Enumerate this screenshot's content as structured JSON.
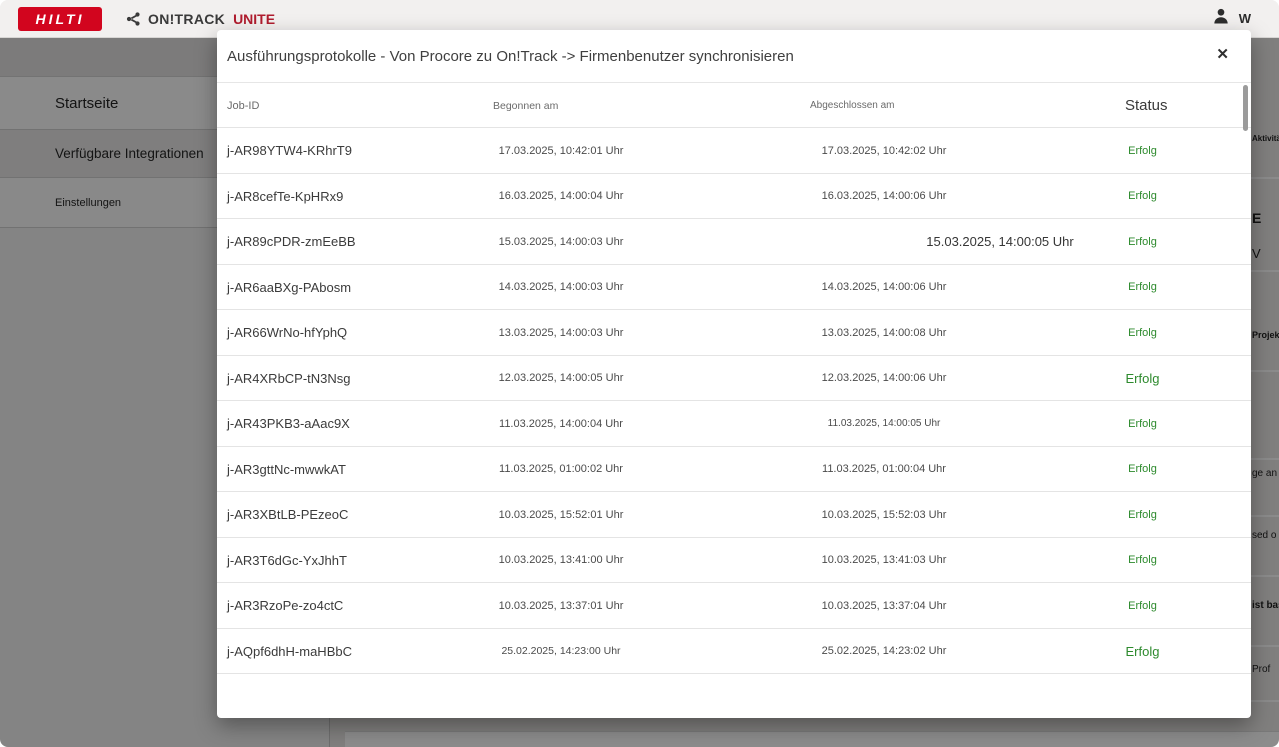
{
  "header": {
    "logo_text": "HILTI",
    "brand_name": "ON!TRACK",
    "brand_suffix": "UNITE",
    "user_name": "W"
  },
  "sidebar": {
    "items": [
      {
        "label": "Startseite"
      },
      {
        "label": "Verfügbare Integrationen"
      },
      {
        "label": "Einstellungen"
      }
    ]
  },
  "background_fragments": [
    "Aktivitä",
    "E",
    "V",
    "Projekt",
    "ge an",
    "sed o",
    "ist bas",
    "Prof"
  ],
  "modal": {
    "title": "Ausführungsprotokolle - Von Procore zu On!Track -> Firmenbenutzer synchronisieren",
    "close_icon": "✕",
    "table": {
      "columns": [
        "Job-ID",
        "Begonnen am",
        "Abgeschlossen am",
        "Status"
      ],
      "rows": [
        {
          "job_id": "j-AR98YTW4-KRhrT9",
          "started": "17.03.2025, 10:42:01 Uhr",
          "completed": "17.03.2025, 10:42:02 Uhr",
          "status": "Erfolg"
        },
        {
          "job_id": "j-AR8cefTe-KpHRx9",
          "started": "16.03.2025, 14:00:04 Uhr",
          "completed": "16.03.2025, 14:00:06 Uhr",
          "status": "Erfolg"
        },
        {
          "job_id": "j-AR89cPDR-zmEeBB",
          "started": "15.03.2025, 14:00:03 Uhr",
          "completed": "15.03.2025, 14:00:05 Uhr",
          "status": "Erfolg"
        },
        {
          "job_id": "j-AR6aaBXg-PAbosm",
          "started": "14.03.2025, 14:00:03 Uhr",
          "completed": "14.03.2025, 14:00:06 Uhr",
          "status": "Erfolg"
        },
        {
          "job_id": "j-AR66WrNo-hfYphQ",
          "started": "13.03.2025, 14:00:03 Uhr",
          "completed": "13.03.2025, 14:00:08 Uhr",
          "status": "Erfolg"
        },
        {
          "job_id": "j-AR4XRbCP-tN3Nsg",
          "started": "12.03.2025, 14:00:05 Uhr",
          "completed": "12.03.2025, 14:00:06 Uhr",
          "status": "Erfolg"
        },
        {
          "job_id": "j-AR43PKB3-aAac9X",
          "started": "11.03.2025, 14:00:04 Uhr",
          "completed": "11.03.2025, 14:00:05 Uhr",
          "status": "Erfolg"
        },
        {
          "job_id": "j-AR3gttNc-mwwkAT",
          "started": "11.03.2025, 01:00:02 Uhr",
          "completed": "11.03.2025, 01:00:04 Uhr",
          "status": "Erfolg"
        },
        {
          "job_id": "j-AR3XBtLB-PEzeoC",
          "started": "10.03.2025, 15:52:01 Uhr",
          "completed": "10.03.2025, 15:52:03 Uhr",
          "status": "Erfolg"
        },
        {
          "job_id": "j-AR3T6dGc-YxJhhT",
          "started": "10.03.2025, 13:41:00 Uhr",
          "completed": "10.03.2025, 13:41:03 Uhr",
          "status": "Erfolg"
        },
        {
          "job_id": "j-AR3RzoPe-zo4ctC",
          "started": "10.03.2025, 13:37:01 Uhr",
          "completed": "10.03.2025, 13:37:04 Uhr",
          "status": "Erfolg"
        },
        {
          "job_id": "j-AQpf6dhH-maHBbC",
          "started": "25.02.2025, 14:23:00 Uhr",
          "completed": "25.02.2025, 14:23:02 Uhr",
          "status": "Erfolg"
        }
      ]
    }
  },
  "colors": {
    "accent_red": "#d2051e",
    "status_success_green": "#2d8a2d",
    "overlay": "rgba(0,0,0,0.45)"
  }
}
